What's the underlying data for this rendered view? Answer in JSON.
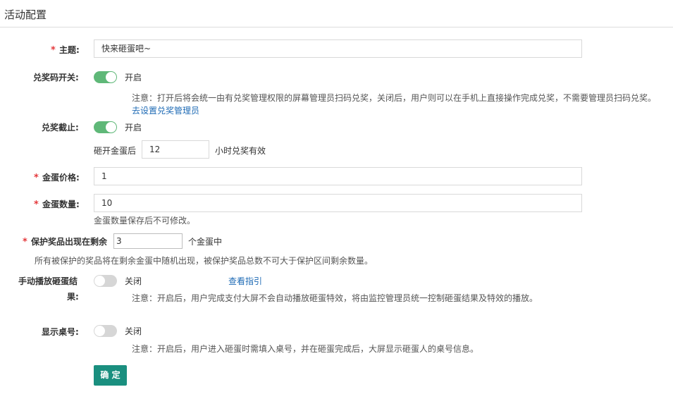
{
  "page": {
    "title": "活动配置"
  },
  "theme": {
    "label": "主题:",
    "value": "快来砸蛋吧~"
  },
  "prize_code": {
    "label": "兑奖码开关:",
    "state": "开启",
    "note": "注意：打开后将会统一由有兑奖管理权限的屏幕管理员扫码兑奖，关闭后，用户则可以在手机上直接操作完成兑奖，不需要管理员扫码兑奖。",
    "link": "去设置兑奖管理员"
  },
  "prize_deadline": {
    "label": "兑奖截止:",
    "state": "开启",
    "prefix": "砸开金蛋后",
    "value": "12",
    "suffix": "小时兑奖有效"
  },
  "egg_price": {
    "label": "金蛋价格:",
    "value": "1"
  },
  "egg_count": {
    "label": "金蛋数量:",
    "value": "10",
    "note": "金蛋数量保存后不可修改。"
  },
  "protected_prize": {
    "label": "保护奖品出现在剩余",
    "value": "3",
    "suffix": "个金蛋中",
    "note": "所有被保护的奖品将在剩余金蛋中随机出现，被保护奖品总数不可大于保护区间剩余数量。"
  },
  "manual_play": {
    "label_line1": "手动播放砸蛋结",
    "label_line2": "果:",
    "state": "关闭",
    "link": "查看指引",
    "note": "注意：开启后，用户完成支付大屏不会自动播放砸蛋特效，将由监控管理员统一控制砸蛋结果及特效的播放。"
  },
  "show_table": {
    "label": "显示桌号:",
    "state": "关闭",
    "note": "注意：开启后，用户进入砸蛋时需填入桌号，并在砸蛋完成后，大屏显示砸蛋人的桌号信息。"
  },
  "confirm_button": {
    "label": "确 定"
  },
  "required_mark": "*"
}
